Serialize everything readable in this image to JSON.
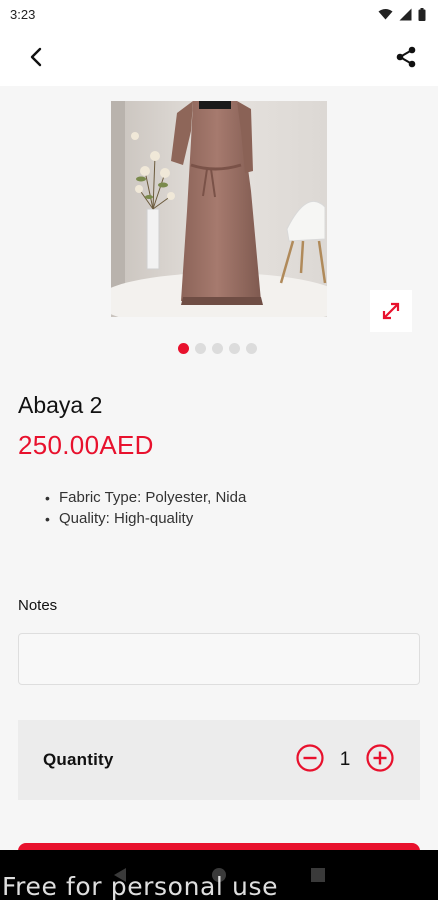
{
  "status_bar": {
    "time": "3:23",
    "icons": [
      "wifi-icon",
      "signal-icon",
      "battery-icon"
    ]
  },
  "app_bar": {
    "back_icon": "chevron-left-icon",
    "share_icon": "share-icon"
  },
  "gallery": {
    "image_count": 5,
    "active_index": 0,
    "expand_icon": "expand-icon"
  },
  "product": {
    "title": "Abaya 2",
    "price": "250.00AED",
    "features": [
      "Fabric Type: Polyester, Nida",
      "Quality: High-quality"
    ]
  },
  "notes": {
    "label": "Notes",
    "value": "",
    "placeholder": ""
  },
  "quantity": {
    "label": "Quantity",
    "value": "1",
    "decrement_icon": "minus-circle-icon",
    "increment_icon": "plus-circle-icon"
  },
  "nav_bar": {
    "icons": [
      "back-triangle-icon",
      "home-circle-icon",
      "recents-square-icon"
    ]
  },
  "watermark": "Free for personal use",
  "colors": {
    "accent": "#e8112d",
    "background": "#f6f6f6",
    "surface": "#ffffff",
    "quantity_bg": "#ececec"
  }
}
